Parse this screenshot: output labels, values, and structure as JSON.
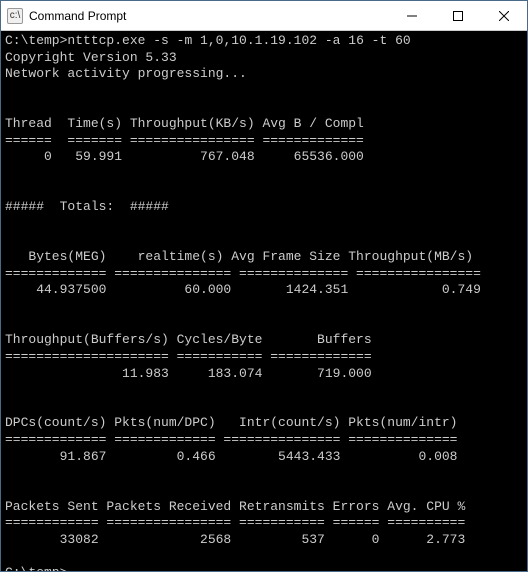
{
  "window": {
    "title": "Command Prompt",
    "icon_label": "cmd-icon"
  },
  "prompt": "C:\\temp>",
  "command": "ntttcp.exe -s -m 1,0,10.1.19.102 -a 16 -t 60",
  "copyright": "Copyright Version 5.33",
  "progress": "Network activity progressing...",
  "section1": {
    "header": "Thread  Time(s) Throughput(KB/s) Avg B / Compl",
    "divider": "======  ======= ================ =============",
    "row": "     0   59.991          767.048     65536.000"
  },
  "totals_label": "#####  Totals:  #####",
  "section2": {
    "header": "   Bytes(MEG)    realtime(s) Avg Frame Size Throughput(MB/s)",
    "divider": "============= =============== ============== ================",
    "row": "    44.937500          60.000       1424.351            0.749"
  },
  "section3": {
    "header": "Throughput(Buffers/s) Cycles/Byte       Buffers",
    "divider": "===================== =========== =============",
    "row": "               11.983     183.074       719.000"
  },
  "section4": {
    "header": "DPCs(count/s) Pkts(num/DPC)   Intr(count/s) Pkts(num/intr)",
    "divider": "============= ============= =============== ==============",
    "row": "       91.867         0.466        5443.433          0.008"
  },
  "section5": {
    "header": "Packets Sent Packets Received Retransmits Errors Avg. CPU %",
    "divider": "============ ================ =========== ====== ==========",
    "row": "       33082             2568         537      0      2.773"
  },
  "chart_data": {
    "type": "table",
    "thread": {
      "id": 0,
      "time_s": 59.991,
      "throughput_kbs": 767.048,
      "avg_b_per_compl": 65536.0
    },
    "totals": {
      "bytes_meg": 44.9375,
      "realtime_s": 60.0,
      "avg_frame_size": 1424.351,
      "throughput_mbs": 0.749,
      "throughput_buffers_s": 11.983,
      "cycles_per_byte": 183.074,
      "buffers": 719.0,
      "dpcs_count_s": 91.867,
      "pkts_num_dpc": 0.466,
      "intr_count_s": 5443.433,
      "pkts_num_intr": 0.008,
      "packets_sent": 33082,
      "packets_received": 2568,
      "retransmits": 537,
      "errors": 0,
      "avg_cpu_pct": 2.773
    }
  }
}
